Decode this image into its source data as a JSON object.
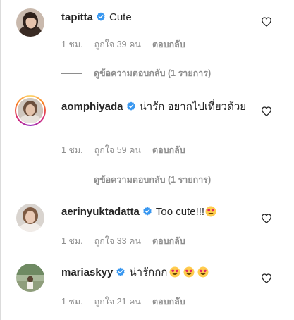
{
  "comments": [
    {
      "username": "tapitta",
      "text": "Cute",
      "emojis": 0,
      "time": "1 ชม.",
      "likes": "ถูกใจ 39 คน",
      "reply": "ตอบกลับ",
      "view_replies": "ดูข้อความตอบกลับ (1 รายการ)"
    },
    {
      "username": "aomphiyada",
      "text": "น่ารัก อยากไปเที่ยวด้วย",
      "emojis": 0,
      "time": "1 ชม.",
      "likes": "ถูกใจ 59 คน",
      "reply": "ตอบกลับ",
      "view_replies": "ดูข้อความตอบกลับ (1 รายการ)"
    },
    {
      "username": "aerinyuktadatta",
      "text": "Too cute!!!",
      "emojis": 1,
      "time": "1 ชม.",
      "likes": "ถูกใจ 33 คน",
      "reply": "ตอบกลับ"
    },
    {
      "username": "mariaskyy",
      "text": "น่ารักกก",
      "emojis": 3,
      "time": "1 ชม.",
      "likes": "ถูกใจ 21 คน",
      "reply": "ตอบกลับ"
    }
  ],
  "icons": {
    "verified": "verified-badge-icon",
    "like": "heart-outline-icon",
    "emoji": "heart-eyes-emoji-icon"
  },
  "colors": {
    "verified": "#3897f0",
    "muted": "#8e8e8e",
    "text": "#262626",
    "emoji_face": "#ffcc4d",
    "emoji_heart": "#e0245e"
  }
}
